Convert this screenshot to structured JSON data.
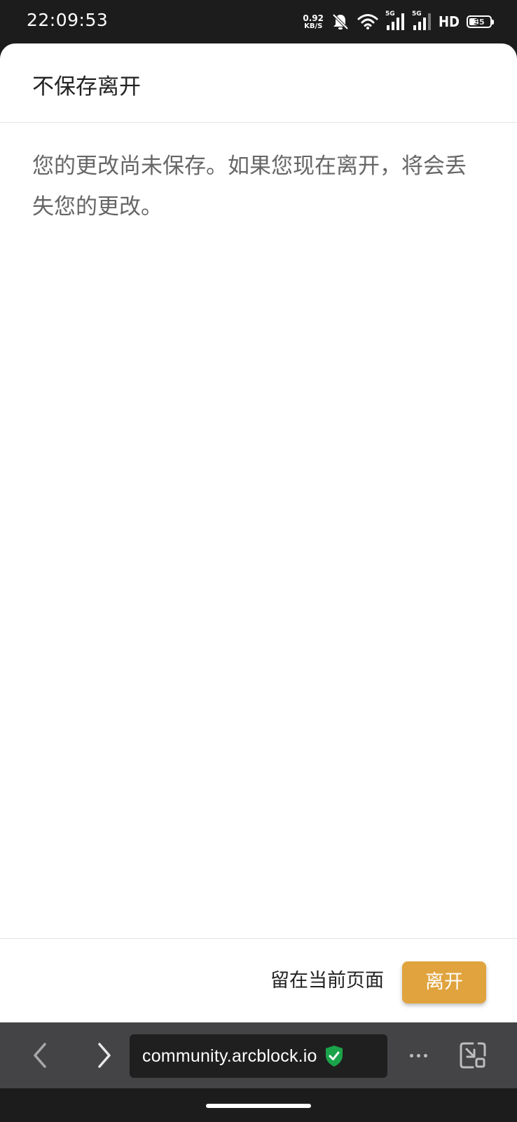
{
  "status_bar": {
    "time": "22:09:53",
    "net_speed_value": "0.92",
    "net_speed_unit": "KB/S",
    "network_label_1": "5G",
    "network_label_2": "5G",
    "hd_label": "HD",
    "battery_level": "35",
    "icons": [
      "mute-bell-icon",
      "wifi-icon",
      "signal-icon",
      "signal-icon",
      "battery-icon"
    ]
  },
  "dialog": {
    "title": "不保存离开",
    "message": "您的更改尚未保存。如果您现在离开，将会丢失您的更改。",
    "stay_label": "留在当前页面",
    "leave_label": "离开"
  },
  "browser": {
    "url": "community.arcblock.io",
    "icons": [
      "back-arrow-icon",
      "forward-arrow-icon",
      "secure-shield-icon",
      "more-icon",
      "minimize-window-icon"
    ]
  },
  "colors": {
    "accent": "#e0a33e",
    "toolbar": "#444446",
    "status_bar": "#1c1c1c",
    "shield": "#1aa34a"
  }
}
